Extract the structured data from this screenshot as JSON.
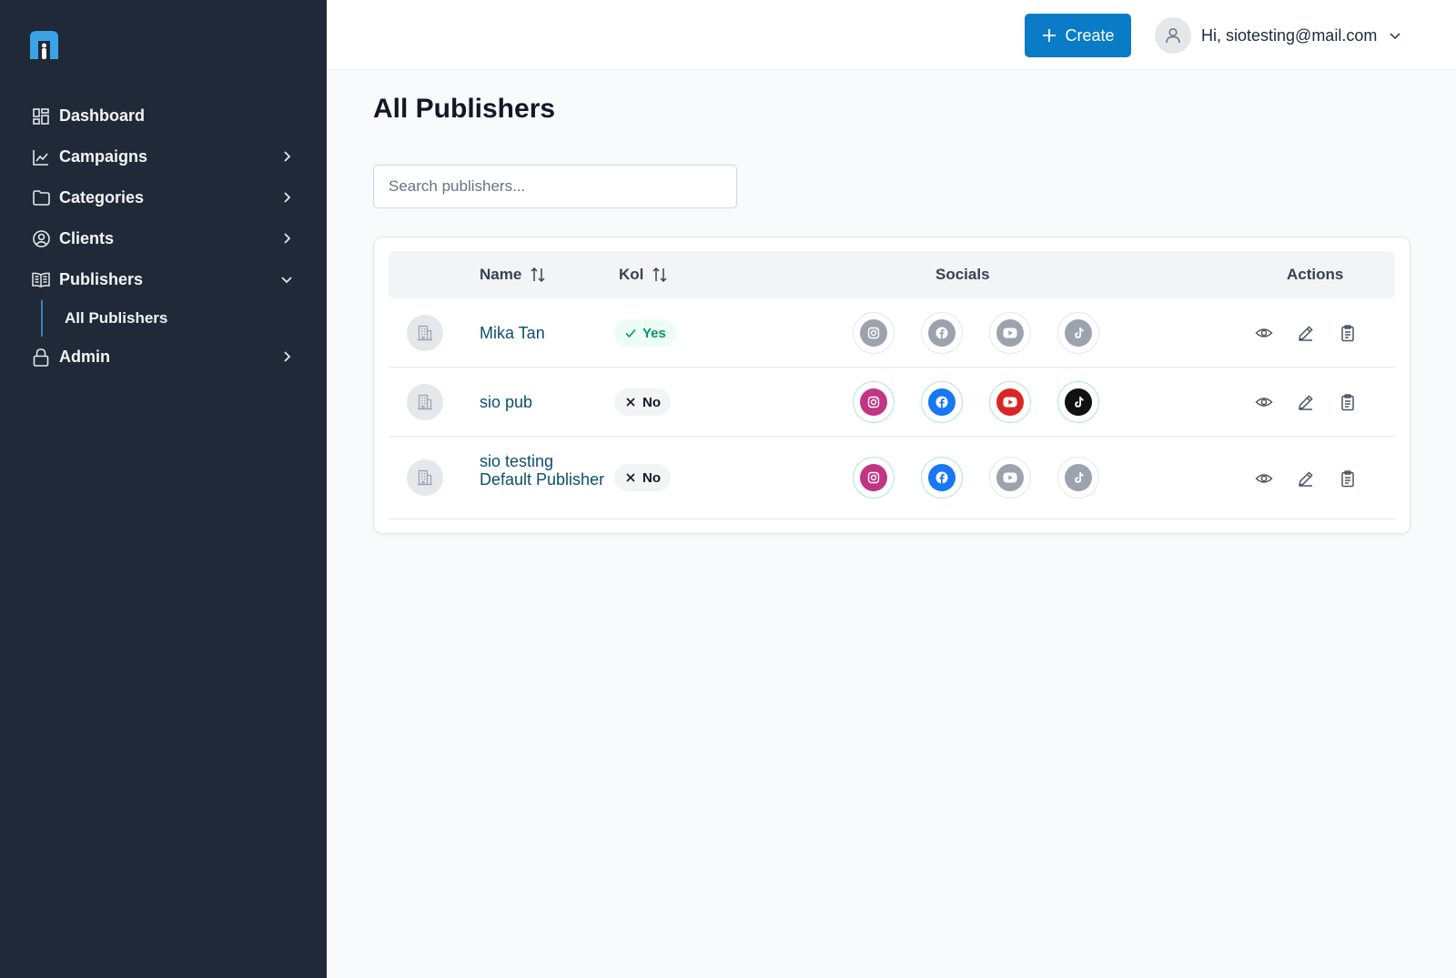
{
  "sidebar": {
    "logo_icon": "app-logo-icon",
    "items": [
      {
        "label": "Dashboard",
        "icon": "dashboard-icon"
      },
      {
        "label": "Campaigns",
        "icon": "chart-line-icon"
      },
      {
        "label": "Categories",
        "icon": "folder-icon"
      },
      {
        "label": "Clients",
        "icon": "user-circle-icon"
      },
      {
        "label": "Publishers",
        "icon": "book-open-icon"
      },
      {
        "label": "Admin",
        "icon": "lock-icon"
      }
    ],
    "sub_items": [
      {
        "label": "All Publishers"
      }
    ]
  },
  "header": {
    "create_label": "Create",
    "user_greeting": "Hi, siotesting@mail.com"
  },
  "main": {
    "title": "All Publishers",
    "search_placeholder": "Search publishers..."
  },
  "table": {
    "columns": {
      "name": "Name",
      "kol": "Kol",
      "socials": "Socials",
      "actions": "Actions"
    },
    "rows": [
      {
        "name": "Mika Tan",
        "kol": "Yes",
        "socials": [
          false,
          false,
          false,
          false
        ]
      },
      {
        "name": "sio pub",
        "kol": "No",
        "socials": [
          true,
          true,
          true,
          true
        ]
      },
      {
        "name": "sio testing Default Publisher",
        "kol": "No",
        "socials": [
          true,
          true,
          false,
          false
        ]
      }
    ]
  },
  "colors": {
    "sidebar_bg": "#1f2937",
    "primary": "#0a7bc6",
    "instagram": "#c13584",
    "facebook": "#1877f2",
    "youtube": "#dc2626",
    "tiktok": "#111111",
    "inactive": "#9ca3af"
  }
}
